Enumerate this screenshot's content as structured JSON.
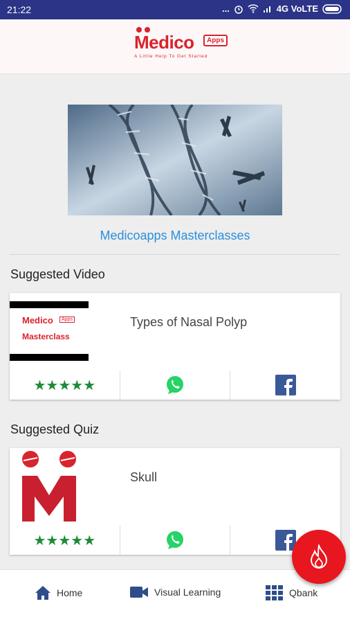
{
  "status_bar": {
    "time": "21:22",
    "dots": "...",
    "network": "4G VoLTE"
  },
  "app_bar": {
    "logo_text": "Medico",
    "logo_badge": "Apps",
    "logo_tagline": "A Little Help To Get Started"
  },
  "banner": {
    "caption": "Medicoapps Masterclasses"
  },
  "suggested_video": {
    "section_title": "Suggested Video",
    "title": "Types of Nasal Polyp",
    "thumb_line1": "Medico",
    "thumb_badge": "Apps",
    "thumb_line2": "Masterclass",
    "rating": "★★★★★"
  },
  "suggested_quiz": {
    "section_title": "Suggested Quiz",
    "title": "Skull",
    "rating": "★★★★★"
  },
  "bottom_nav": {
    "home": "Home",
    "visual": "Visual Learning",
    "qbank": "Qbank"
  },
  "colors": {
    "status_bar": "#2b3486",
    "brand_red": "#d9232d",
    "link_blue": "#2a8fdc",
    "star_green": "#1e8a3a",
    "nav_blue": "#2f4d8a"
  }
}
